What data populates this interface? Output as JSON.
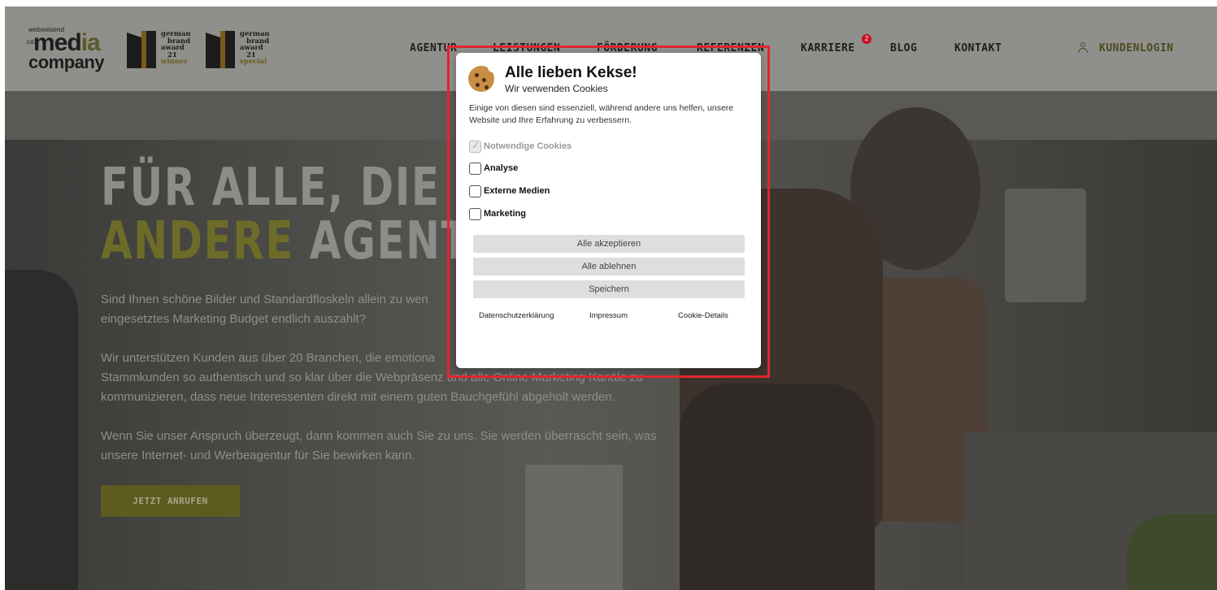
{
  "header": {
    "logo": {
      "small": "webweisend",
      "die": "DIE",
      "media": "med",
      "media_a": "ia",
      "company": "company"
    },
    "awards": [
      {
        "line1": "german",
        "line2": "brand",
        "line3": "award",
        "line4": "21",
        "kind": "winner"
      },
      {
        "line1": "german",
        "line2": "brand",
        "line3": "award",
        "line4": "21",
        "kind": "special"
      }
    ],
    "nav": [
      "AGENTUR",
      "LEISTUNGEN",
      "FÖRDERUNG",
      "REFERENZEN",
      "KARRIERE",
      "BLOG",
      "KONTAKT"
    ],
    "karriere_badge": "2",
    "login": "KUNDENLOGIN",
    "bg_color": "#8f8f8c",
    "accent": "#4e4a20"
  },
  "hero": {
    "headline_line1": "FÜR ALLE, DIE EIN",
    "headline_line2_accent": "ANDERE",
    "headline_line2_rest": " AGENTUR",
    "paragraph1": "Sind Ihnen schöne Bilder und Standardfloskeln allein zu wen",
    "paragraph1_cont": "eingesetztes Marketing Budget endlich auszahlt?",
    "paragraph2": "Wir unterstützen Kunden aus über 20 Branchen, die emotiona",
    "paragraph2_l2": "Stammkunden so authentisch und so klar über die Webpräsenz und alle Online Marketing Kanäle zu",
    "paragraph2_l3": "kommunizieren, dass neue Interessenten direkt mit einem guten Bauchgefühl abgeholt werden.",
    "paragraph3_l1": "Wenn Sie unser Anspruch überzeugt, dann kommen auch Sie zu uns. Sie werden überrascht sein, was",
    "paragraph3_l2": "unsere Internet- und Werbeagentur für Sie bewirken kann.",
    "cta": "JETZT ANRUFEN",
    "accent_color": "#6d6b28"
  },
  "cookie_modal": {
    "title": "Alle lieben Kekse!",
    "subtitle": "Wir verwenden Cookies",
    "description": "Einige von diesen sind essenziell, während andere uns helfen, unsere Website und Ihre Erfahrung zu verbessern.",
    "options": [
      {
        "label": "Notwendige Cookies",
        "checked": true,
        "disabled": true
      },
      {
        "label": "Analyse",
        "checked": false,
        "disabled": false
      },
      {
        "label": "Externe Medien",
        "checked": false,
        "disabled": false
      },
      {
        "label": "Marketing",
        "checked": false,
        "disabled": false
      }
    ],
    "buttons": {
      "accept_all": "Alle akzeptieren",
      "reject_all": "Alle ablehnen",
      "save": "Speichern"
    },
    "links": {
      "privacy": "Datenschutzerklärung",
      "imprint": "Impressum",
      "details": "Cookie-Details"
    },
    "highlight_color": "#e3262e"
  }
}
